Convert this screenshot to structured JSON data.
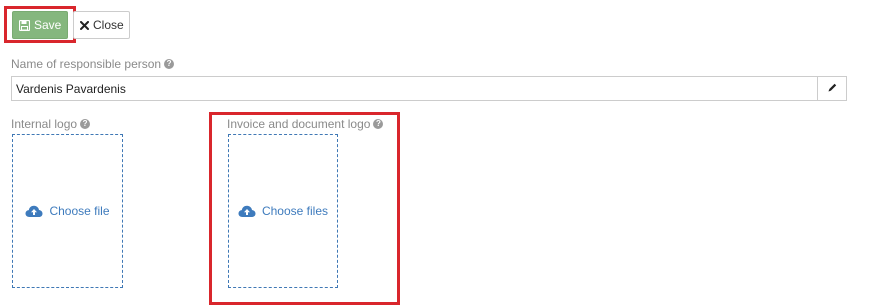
{
  "toolbar": {
    "save_label": "Save",
    "close_label": "Close"
  },
  "form": {
    "responsible_person": {
      "label": "Name of responsible person",
      "value": "Vardenis Pavardenis"
    },
    "internal_logo": {
      "label": "Internal logo",
      "button_label": "Choose file"
    },
    "invoice_logo": {
      "label": "Invoice and document logo",
      "button_label": "Choose files"
    }
  },
  "icons": {
    "save": "floppy-disk-icon",
    "close": "close-x-icon",
    "help": "question-circle-icon",
    "edit": "pencil-icon",
    "upload": "cloud-upload-icon"
  },
  "colors": {
    "save_button": "#85b77e",
    "link": "#3e7bbd",
    "highlight": "#d9262c",
    "dropzone_border": "#3f78b5"
  }
}
